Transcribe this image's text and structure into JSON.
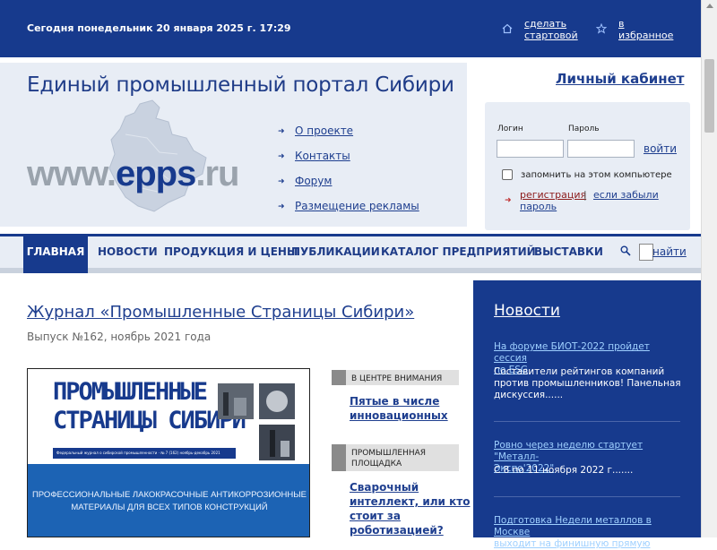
{
  "topbar": {
    "date_text": "Сегодня понедельник 20 января 2025 г. 17:29",
    "start_page_line1": "сделать",
    "start_page_line2": "стартовой",
    "favorites_line1": "в",
    "favorites_line2": "избранное",
    "home_icon": "home-icon",
    "star_icon": "star-icon"
  },
  "header": {
    "site_title": "Единый промышленный портал Сибири",
    "url_prefix": "www.",
    "url_main": "epps",
    "url_suffix": ".ru",
    "nav": [
      "О проекте",
      "Контакты",
      "Форум",
      "Размещение рекламы"
    ]
  },
  "login": {
    "cabinet": "Личный кабинет",
    "login_label": "Логин",
    "password_label": "Пароль",
    "login_value": "",
    "password_value": "",
    "submit": "войти",
    "remember": "запомнить на этом компьютере",
    "register": "регистрация",
    "separator": "|",
    "forgot_line1": "если забыли",
    "forgot_line2": "пароль"
  },
  "menu": {
    "items": [
      "ГЛАВНАЯ",
      "НОВОСТИ",
      "ПРОДУКЦИЯ И ЦЕНЫ",
      "ПУБЛИКАЦИИ",
      "КАТАЛОГ ПРЕДПРИЯТИЙ",
      "ВЫСТАВКИ"
    ],
    "search_button": "найти",
    "search_value": ""
  },
  "main": {
    "journal_title": "Журнал «Промышленные Страницы Сибири»",
    "issue": "Выпуск №162, ноябрь 2021 года",
    "cover": {
      "logo_line1": "ПРОМЫШЛЕННЫЕ",
      "logo_line2": "СТРАНИЦЫ СИБИРИ",
      "strip_text": "Федеральный журнал о сибирской промышленности · № 7 (162) ноябрь-декабрь 2021",
      "panel_line1": "ПРОФЕССИОНАЛЬНЫЕ ЛАКОКРАСОЧНЫЕ АНТИКОРРОЗИОННЫЕ",
      "panel_line2": "МАТЕРИАЛЫ ДЛЯ ВСЕХ ТИПОВ КОНСТРУКЦИЙ"
    },
    "side": [
      {
        "tag": "В ЦЕНТРЕ ВНИМАНИЯ",
        "tag2": "",
        "link_lines": [
          "Пятые в числе",
          "инновационных"
        ]
      },
      {
        "tag": "ПРОМЫШЛЕННАЯ",
        "tag2": "ПЛОЩАДКА",
        "link_lines": [
          "Сварочный",
          "интеллект, или кто",
          "стоит за",
          "роботизацией?"
        ]
      }
    ]
  },
  "news": {
    "title": "Новости",
    "items": [
      {
        "link_lines": [
          "На форуме БИОТ-2022 пройдет сессия",
          "по ESG"
        ],
        "text_lines": [
          "Составители рейтингов компаний",
          "против промышленников! Панельная",
          "дискуссия......"
        ]
      },
      {
        "link_lines": [
          "Ровно через неделю стартует \"Металл-",
          "Экспо'2022\""
        ],
        "text_lines": [
          "С 8 по 11 ноября 2022 г......."
        ]
      },
      {
        "link_lines": [
          "Подготовка Недели металлов в Москве",
          "выходит на финишную прямую"
        ],
        "text_lines": []
      }
    ]
  },
  "colors": {
    "brand_blue": "#173a8d",
    "light_bg": "#e8edf5",
    "link_blue": "#1f3f8f"
  }
}
